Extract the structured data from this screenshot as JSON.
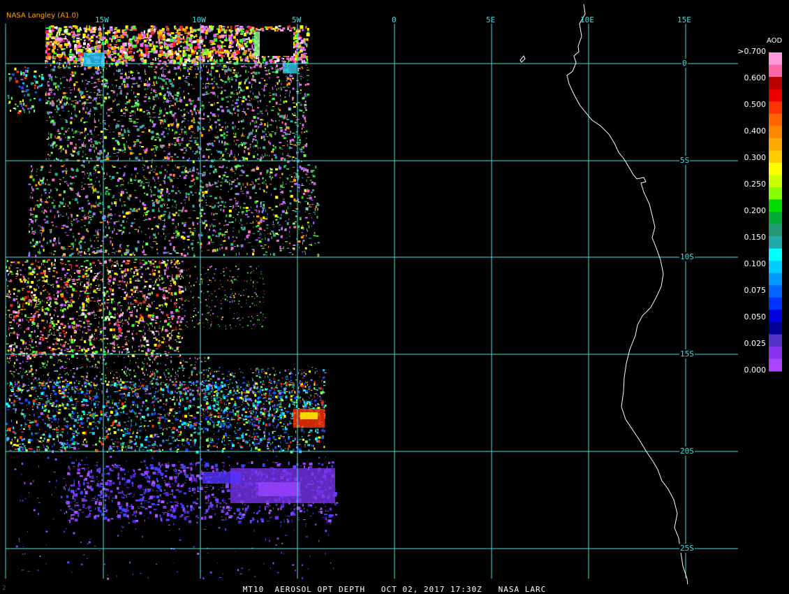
{
  "credit": "NASA Langley (A1.0)",
  "footer": {
    "title": "MT10  AEROSOL OPT DEPTH   OCT 02, 2017 17:30Z   NASA LARC",
    "mark": "2"
  },
  "colors": {
    "grid": "#40e0e0",
    "credit": "#ffa500",
    "coast": "#ffffff",
    "footer_text": "#ffffff"
  },
  "grid": {
    "lon_labels": [
      "15W",
      "10W",
      "5W",
      "0",
      "5E",
      "10E",
      "15E"
    ],
    "lat_labels": [
      "0",
      "5S",
      "10S",
      "15S",
      "20S",
      "25S"
    ]
  },
  "legend": {
    "title": "AOD",
    "ticks": [
      ">0.700",
      "0.600",
      "0.500",
      "0.400",
      "0.300",
      "0.250",
      "0.200",
      "0.150",
      "0.100",
      "0.075",
      "0.050",
      "0.025",
      "0.000"
    ],
    "colors": [
      "#ff99dd",
      "#ff66aa",
      "#bb0000",
      "#ee0000",
      "#ff3300",
      "#ff6600",
      "#ff8800",
      "#ffaa00",
      "#ffcc00",
      "#ffff00",
      "#ccff00",
      "#88ff00",
      "#00dd00",
      "#00aa33",
      "#229977",
      "#22aaaa",
      "#00ffff",
      "#00ccff",
      "#0099ff",
      "#0066ff",
      "#0033ff",
      "#0000dd",
      "#000099",
      "#5533cc",
      "#8833ee",
      "#aa44ff"
    ]
  },
  "palette": {
    "high": [
      "#ff66cc",
      "#cc66ff",
      "#ffff00",
      "#ff8800",
      "#ee2222",
      "#99ff33",
      "#ffffff",
      "#33ff33",
      "#ff99ff",
      "#ffcc00"
    ],
    "mid": [
      "#aa66ff",
      "#cc66ff",
      "#22bb88",
      "#33cc33",
      "#66ff66",
      "#ffff00",
      "#ff66cc",
      "#33aaaa",
      "#ff9900"
    ],
    "low": [
      "#22ccff",
      "#0066ff",
      "#00ffff",
      "#229977",
      "#2244ff",
      "#66ff66",
      "#aa66ff",
      "#ff3300",
      "#ffff00"
    ],
    "violet": [
      "#7733ee",
      "#9944ff",
      "#5522cc",
      "#aa55ff",
      "#6644ff",
      "#3344ff"
    ]
  }
}
